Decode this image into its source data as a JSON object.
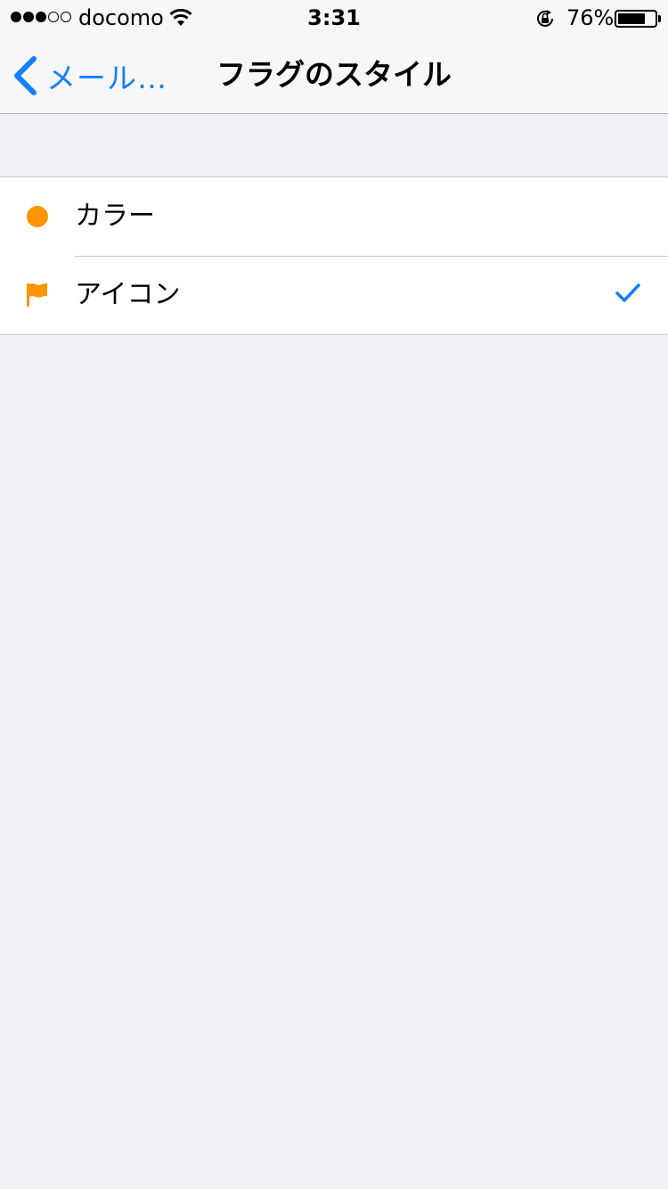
{
  "status_bar": {
    "carrier": "docomo",
    "time": "3:31",
    "battery_percent": "76%",
    "battery_level": 0.76,
    "signal_bars_filled": 3,
    "signal_bars_total": 5
  },
  "nav_bar": {
    "back_label": "メール…",
    "title": "フラグのスタイル"
  },
  "options": [
    {
      "label": "カラー",
      "icon": "orange-dot-icon",
      "selected": false
    },
    {
      "label": "アイコン",
      "icon": "flag-icon",
      "selected": true
    }
  ],
  "colors": {
    "accent": "#147efb",
    "flag_orange": "#ff9500",
    "background": "#efeff4"
  }
}
